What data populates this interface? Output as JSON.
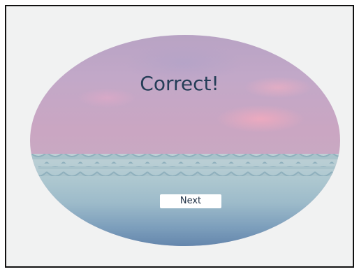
{
  "feedback": {
    "title": "Correct!"
  },
  "actions": {
    "next_label": "Next"
  },
  "colors": {
    "frame_border": "#111111",
    "frame_background": "#f1f2f2",
    "title_text": "#243d57",
    "button_background": "#ffffff",
    "button_text": "#1e2f44",
    "water_top": "#bfd1d6",
    "water_bottom": "#5d7fa8",
    "sky": "#c2a8c8"
  }
}
